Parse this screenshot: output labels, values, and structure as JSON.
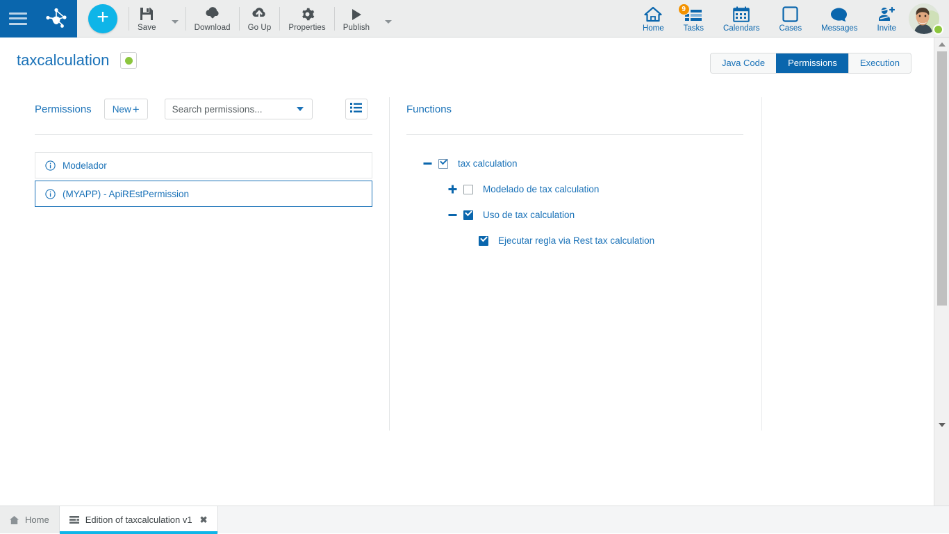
{
  "app": {
    "brand_color": "#0a66ad",
    "accent_color": "#0fb5e8",
    "link_color": "#1a72b8",
    "status_green": "#8cc63e",
    "badge_orange": "#f39200"
  },
  "toolbar": {
    "menu_icon": "hamburger-icon",
    "logo_icon": "bizagi-logo-icon",
    "create_label": "+",
    "items": [
      {
        "label": "Save",
        "icon": "save-icon",
        "has_caret": true
      },
      {
        "label": "Download",
        "icon": "download-cloud-icon",
        "has_caret": false
      },
      {
        "label": "Go Up",
        "icon": "upload-cloud-icon",
        "has_caret": false
      },
      {
        "label": "Properties",
        "icon": "gear-icon",
        "has_caret": false
      },
      {
        "label": "Publish",
        "icon": "play-icon",
        "has_caret": true
      }
    ]
  },
  "right_nav": {
    "items": [
      {
        "label": "Home",
        "icon": "home-icon",
        "badge": ""
      },
      {
        "label": "Tasks",
        "icon": "tasks-icon",
        "badge": "9"
      },
      {
        "label": "Calendars",
        "icon": "calendar-icon",
        "badge": ""
      },
      {
        "label": "Cases",
        "icon": "cases-square-icon",
        "badge": ""
      },
      {
        "label": "Messages",
        "icon": "speech-bubble-icon",
        "badge": ""
      },
      {
        "label": "Invite",
        "icon": "invite-user-icon",
        "badge": ""
      }
    ],
    "avatar": "user-avatar",
    "presence": "online"
  },
  "page": {
    "title": "taxcalculation",
    "status_indicator": "published-green-dot",
    "tabs": [
      {
        "label": "Java Code",
        "active": false
      },
      {
        "label": "Permissions",
        "active": true
      },
      {
        "label": "Execution",
        "active": false
      }
    ]
  },
  "permissions_panel": {
    "title": "Permissions",
    "new_button": "New",
    "new_icon": "plus-icon",
    "search_placeholder": "Search permissions...",
    "search_value": "",
    "dropdown_icon": "chevron-down-icon",
    "list_view_icon": "list-view-icon",
    "items": [
      {
        "label": "Modelador",
        "icon": "info-circle-icon",
        "selected": false
      },
      {
        "label": "(MYAPP) - ApiREstPermission",
        "icon": "info-circle-icon",
        "selected": true
      }
    ]
  },
  "functions_panel": {
    "title": "Functions",
    "tree": [
      {
        "label": "tax calculation",
        "indent": 0,
        "toggle": "minus",
        "checkbox": "checked-outline"
      },
      {
        "label": "Modelado de tax calculation",
        "indent": 1,
        "toggle": "plus",
        "checkbox": "unchecked"
      },
      {
        "label": "Uso de tax calculation",
        "indent": 1,
        "toggle": "minus",
        "checkbox": "checked"
      },
      {
        "label": "Ejecutar regla via Rest tax calculation",
        "indent": 2,
        "toggle": "none",
        "checkbox": "checked"
      }
    ]
  },
  "scrollbar": {
    "up_icon": "triangle-up-icon",
    "down_icon": "triangle-down-icon",
    "position": "top"
  },
  "taskbar": {
    "tabs": [
      {
        "label": "Home",
        "icon": "home-small-icon",
        "active": false,
        "closable": false
      },
      {
        "label": "Edition of taxcalculation v1",
        "icon": "document-lines-icon",
        "active": true,
        "closable": true,
        "close_icon": "close-x-icon"
      }
    ]
  }
}
